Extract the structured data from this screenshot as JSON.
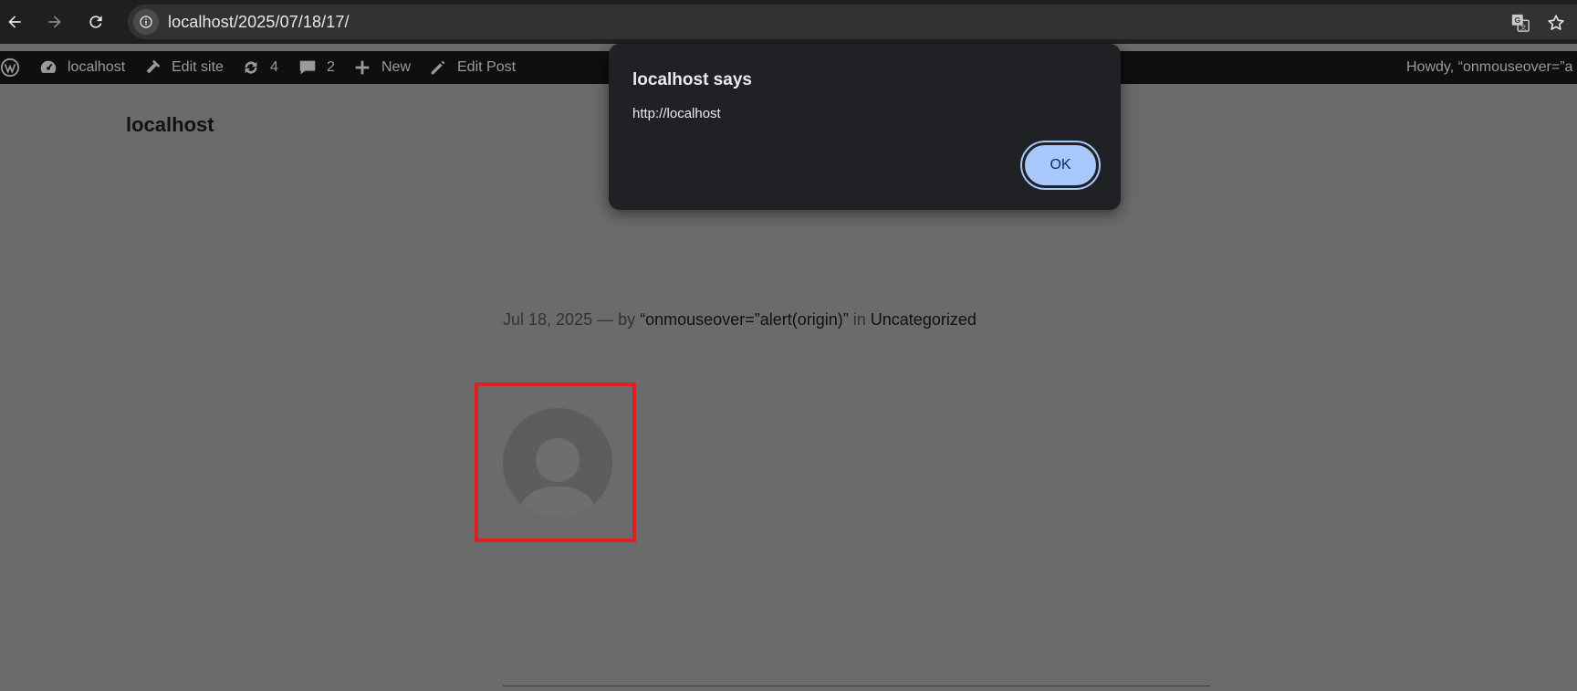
{
  "browser": {
    "url": "localhost/2025/07/18/17/",
    "icons": [
      "back-arrow-icon",
      "forward-arrow-icon",
      "reload-icon",
      "site-info-icon",
      "translate-icon",
      "bookmark-star-icon"
    ]
  },
  "admin_bar": {
    "site_name": "localhost",
    "edit_site": "Edit site",
    "updates_count": "4",
    "comments_count": "2",
    "new": "New",
    "edit_post": "Edit Post",
    "howdy": "Howdy, “onmouseover=”a"
  },
  "page": {
    "site_title": "localhost",
    "meta": {
      "date": "Jul 18, 2025",
      "separator": "—",
      "by": "by",
      "author": "“onmouseover=”alert(origin)”",
      "in": "in",
      "category": "Uncategorized"
    }
  },
  "dialog": {
    "title": "localhost says",
    "message": "http://localhost",
    "ok_label": "OK"
  },
  "colors": {
    "highlight": "#e02020",
    "ok_button": "#a8c7fa",
    "dialog_bg": "#202124",
    "page_overlay": "#6b6b6b"
  }
}
